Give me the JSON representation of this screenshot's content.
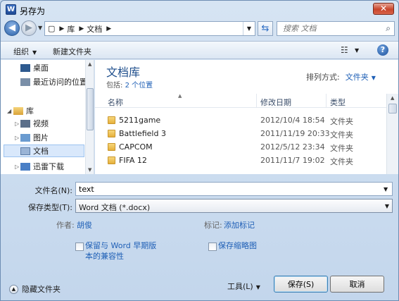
{
  "window": {
    "title": "另存为",
    "app_icon": "W",
    "close_symbol": "✕"
  },
  "nav": {
    "back_symbol": "◀",
    "forward_symbol": "▶",
    "breadcrumbs": [
      "库",
      "文档"
    ],
    "search_placeholder": "搜索 文档"
  },
  "toolbar": {
    "organize_label": "组织",
    "new_folder_label": "新建文件夹",
    "help_symbol": "?"
  },
  "sidebar": {
    "items": [
      {
        "label": "桌面",
        "icon": "desktop-icon"
      },
      {
        "label": "最近访问的位置",
        "icon": "recent-places-icon"
      },
      {
        "label": "库",
        "icon": "library-icon"
      },
      {
        "label": "视频",
        "icon": "video-icon"
      },
      {
        "label": "图片",
        "icon": "picture-icon"
      },
      {
        "label": "文档",
        "icon": "document-icon"
      },
      {
        "label": "迅雷下载",
        "icon": "thunder-download-icon"
      }
    ]
  },
  "main": {
    "library_title": "文档库",
    "library_sub_prefix": "包括:",
    "library_sub_link": "2 个位置",
    "arrange_label": "排列方式:",
    "arrange_value": "文件夹",
    "columns": {
      "name": "名称",
      "date": "修改日期",
      "type": "类型"
    },
    "rows": [
      {
        "name": "5211game",
        "date": "2012/10/4 18:54",
        "type": "文件夹"
      },
      {
        "name": "Battlefield 3",
        "date": "2011/11/19 20:33",
        "type": "文件夹"
      },
      {
        "name": "CAPCOM",
        "date": "2012/5/12 23:34",
        "type": "文件夹"
      },
      {
        "name": "FIFA 12",
        "date": "2011/11/7 19:02",
        "type": "文件夹"
      }
    ]
  },
  "form": {
    "filename_label": "文件名(N):",
    "filename_value": "text",
    "filetype_label": "保存类型(T):",
    "filetype_value": "Word 文档 (*.docx)",
    "author_label": "作者:",
    "author_value": "胡俊",
    "tags_label": "标记:",
    "tags_value": "添加标记",
    "compat_label": "保留与 Word 早期版本的兼容性",
    "thumb_label": "保存缩略图"
  },
  "footer": {
    "hide_folders_label": "隐藏文件夹",
    "tools_label": "工具(L)",
    "save_label": "保存(S)",
    "cancel_label": "取消"
  },
  "colors": {
    "accent": "#1e5fb6",
    "selection": "#d9e8fb",
    "close": "#c8452b"
  }
}
